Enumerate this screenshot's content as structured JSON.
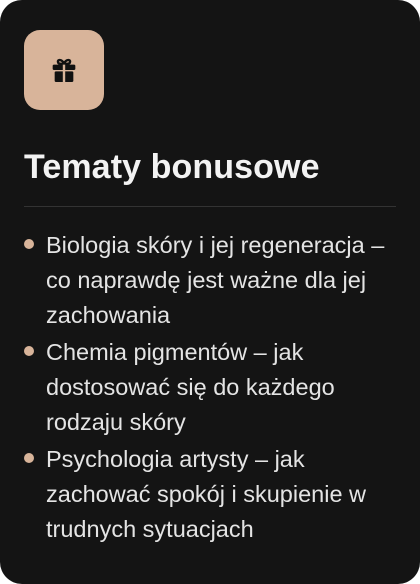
{
  "card": {
    "icon": "gift-icon",
    "accent_color": "#d8b49a",
    "background_color": "#141414",
    "title": "Tematy bonusowe",
    "items": [
      {
        "text": "Biologia skóry i jej regeneracja – co naprawdę jest ważne dla jej zachowania"
      },
      {
        "text": "Chemia pigmentów – jak dostosować się do każdego rodzaju skóry"
      },
      {
        "text": "Psychologia artysty – jak zachować spokój i skupienie w trudnych sytuacjach"
      }
    ]
  }
}
